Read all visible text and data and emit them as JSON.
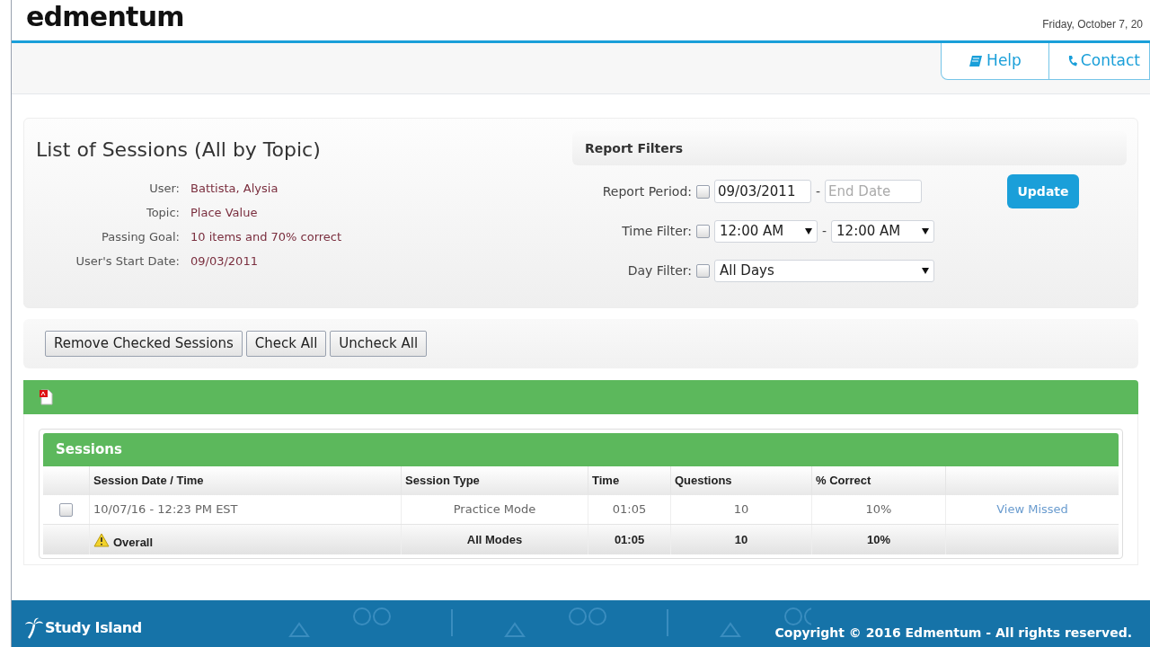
{
  "header": {
    "logo": "edmentum",
    "date": "Friday, October 7, 20"
  },
  "nav": [
    {
      "label": "Help"
    },
    {
      "label": "Contact"
    }
  ],
  "summary": {
    "title": "List of Sessions (All by Topic)",
    "fields": [
      {
        "label": "User:",
        "value": "Battista, Alysia"
      },
      {
        "label": "Topic:",
        "value": "Place Value"
      },
      {
        "label": "Passing Goal:",
        "value": "10 items and 70% correct"
      },
      {
        "label": "User's Start Date:",
        "value": "09/03/2011"
      }
    ]
  },
  "filters": {
    "title": "Report Filters",
    "rows": [
      {
        "label": "Report Period:",
        "checked": false,
        "kind": "dates",
        "from": "09/03/2011",
        "separator": "-",
        "to_placeholder": "End Date"
      },
      {
        "label": "Time Filter:",
        "checked": false,
        "kind": "times",
        "from": "12:00 AM",
        "separator": "-",
        "to": "12:00 AM"
      },
      {
        "label": "Day Filter:",
        "checked": false,
        "kind": "select",
        "value": "All Days"
      }
    ],
    "button": "Update"
  },
  "actions": [
    "Remove Checked Sessions",
    "Check All",
    "Uncheck All"
  ],
  "sessions": {
    "title": "Sessions",
    "columns": [
      "Session Date / Time",
      "Session Type",
      "Time",
      "Questions",
      "% Correct"
    ],
    "rows": [
      {
        "kind": "session",
        "checked": false,
        "date": "10/07/16 - 12:23 PM EST",
        "type": "Practice Mode",
        "time": "01:05",
        "questions": "10",
        "correct": "10%",
        "link": "View Missed"
      },
      {
        "kind": "total",
        "date": "Overall",
        "type": "All Modes",
        "time": "01:05",
        "questions": "10",
        "correct": "10%"
      }
    ]
  },
  "footer": {
    "logo": "Study Island",
    "copyright": "Copyright © 2016 Edmentum - All rights reserved."
  }
}
